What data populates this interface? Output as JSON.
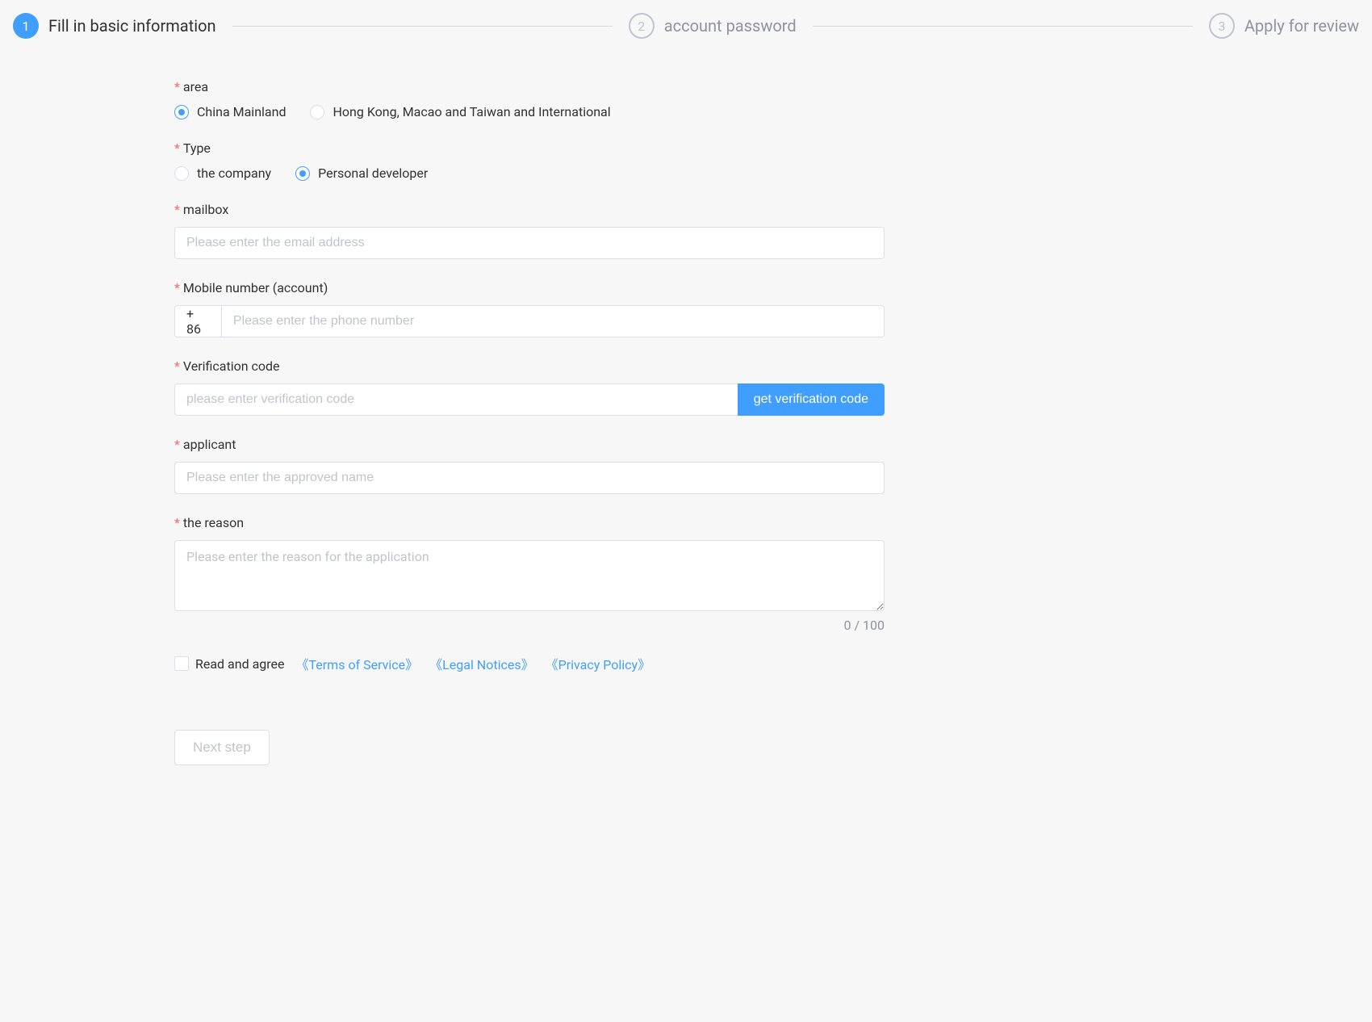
{
  "steps": {
    "s1": {
      "num": "1",
      "title": "Fill in basic information"
    },
    "s2": {
      "num": "2",
      "title": "account password"
    },
    "s3": {
      "num": "3",
      "title": "Apply for review"
    }
  },
  "form": {
    "area": {
      "label": "area",
      "opt1": "China Mainland",
      "opt2": "Hong Kong, Macao and Taiwan and International"
    },
    "type": {
      "label": "Type",
      "opt1": "the company",
      "opt2": "Personal developer"
    },
    "mailbox": {
      "label": "mailbox",
      "placeholder": "Please enter the email address"
    },
    "mobile": {
      "label": "Mobile number (account)",
      "prefix": "+ 86",
      "placeholder": "Please enter the phone number"
    },
    "code": {
      "label": "Verification code",
      "placeholder": "please enter verification code",
      "btn": "get verification code"
    },
    "applicant": {
      "label": "applicant",
      "placeholder": "Please enter the approved name"
    },
    "reason": {
      "label": "the reason",
      "placeholder": "Please enter the reason for the application",
      "count": "0 / 100"
    },
    "agree": {
      "text": "Read and agree",
      "link1": "《Terms of Service》",
      "link2": "《Legal Notices》",
      "link3": "《Privacy Policy》"
    },
    "submit": "Next step"
  }
}
